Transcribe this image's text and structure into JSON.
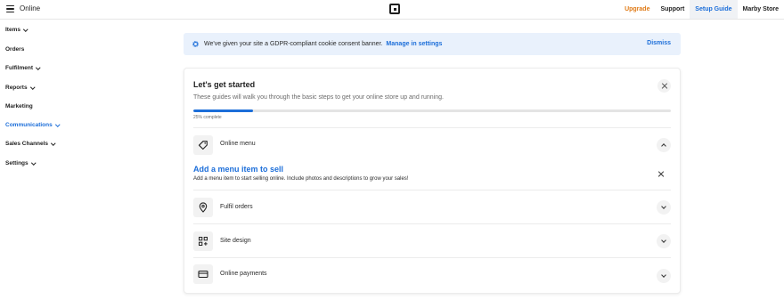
{
  "topbar": {
    "app_name": "Online",
    "nav": [
      {
        "label": "Upgrade",
        "style": "upgrade"
      },
      {
        "label": "Support",
        "style": "normal"
      },
      {
        "label": "Setup Guide",
        "style": "active"
      },
      {
        "label": "Marby Store",
        "style": "normal"
      }
    ]
  },
  "sidebar": {
    "items": [
      {
        "label": "Items",
        "has_chevron": true,
        "active": false
      },
      {
        "label": "Orders",
        "has_chevron": false,
        "active": false
      },
      {
        "label": "Fulfilment",
        "has_chevron": true,
        "active": false
      },
      {
        "label": "Reports",
        "has_chevron": true,
        "active": false
      },
      {
        "label": "Marketing",
        "has_chevron": false,
        "active": false
      },
      {
        "label": "Communications",
        "has_chevron": true,
        "active": true
      },
      {
        "label": "Sales Channels",
        "has_chevron": true,
        "active": false
      },
      {
        "label": "Settings",
        "has_chevron": true,
        "active": false
      }
    ]
  },
  "banner": {
    "text": "We've given your site a GDPR-compliant cookie consent banner.",
    "link": "Manage in settings",
    "dismiss": "Dismiss"
  },
  "guide": {
    "title": "Let's get started",
    "subtitle": "These guides will walk you through the basic steps to get your online store up and running.",
    "progress_percent": 12.5,
    "progress_label": "25% complete",
    "rows": [
      {
        "label": "Online menu",
        "icon": "tag-icon",
        "expanded": true
      },
      {
        "label": "Fulfil orders",
        "icon": "location-pin-icon",
        "expanded": false
      },
      {
        "label": "Site design",
        "icon": "grid-plus-icon",
        "expanded": false
      },
      {
        "label": "Online payments",
        "icon": "credit-card-icon",
        "expanded": false
      }
    ],
    "task": {
      "title": "Add a menu item to sell",
      "description": "Add a menu item to start selling online. Include photos and descriptions to grow your sales!"
    }
  },
  "colors": {
    "accent": "#1c6ed9",
    "upgrade": "#e07b17",
    "banner_bg": "#e9f1fc"
  }
}
